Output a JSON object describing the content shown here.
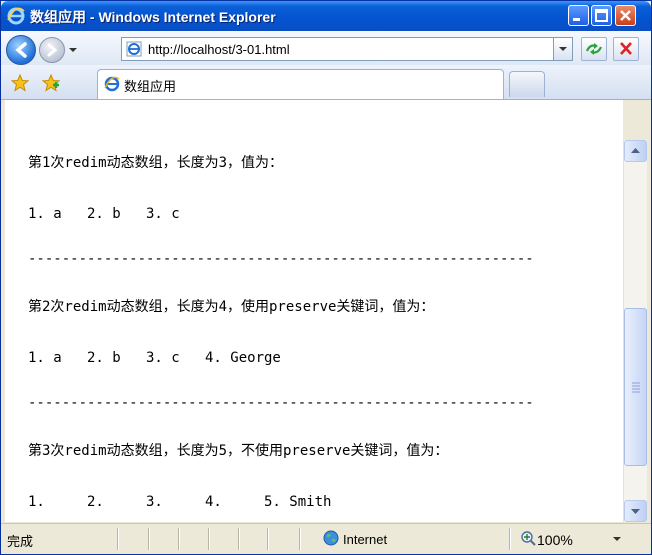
{
  "window": {
    "title": "数组应用 - Windows Internet Explorer",
    "icon": "ie-icon"
  },
  "navbar": {
    "address": "http://localhost/3-01.html",
    "back_icon": "back-arrow-icon",
    "forward_icon": "forward-arrow-icon",
    "refresh_icon": "refresh-icon",
    "stop_icon": "stop-icon"
  },
  "tabs": {
    "active_tab_label": "数组应用"
  },
  "content": {
    "lines": [
      "第1次redim动态数组，长度为3，值为：",
      "1. a   2. b   3. c",
      "------------------------------------------------------------",
      "第2次redim动态数组，长度为4，使用preserve关键词，值为：",
      "1. a   2. b   3. c   4. George",
      "------------------------------------------------------------",
      "第3次redim动态数组，长度为5，不使用preserve关键词，值为：",
      "1.     2.     3.     4.     5. Smith"
    ]
  },
  "status": {
    "done": "完成",
    "zone": "Internet",
    "zoom": "100%"
  },
  "colors": {
    "titlebar": "#0453d0",
    "close_button": "#c8401c"
  }
}
